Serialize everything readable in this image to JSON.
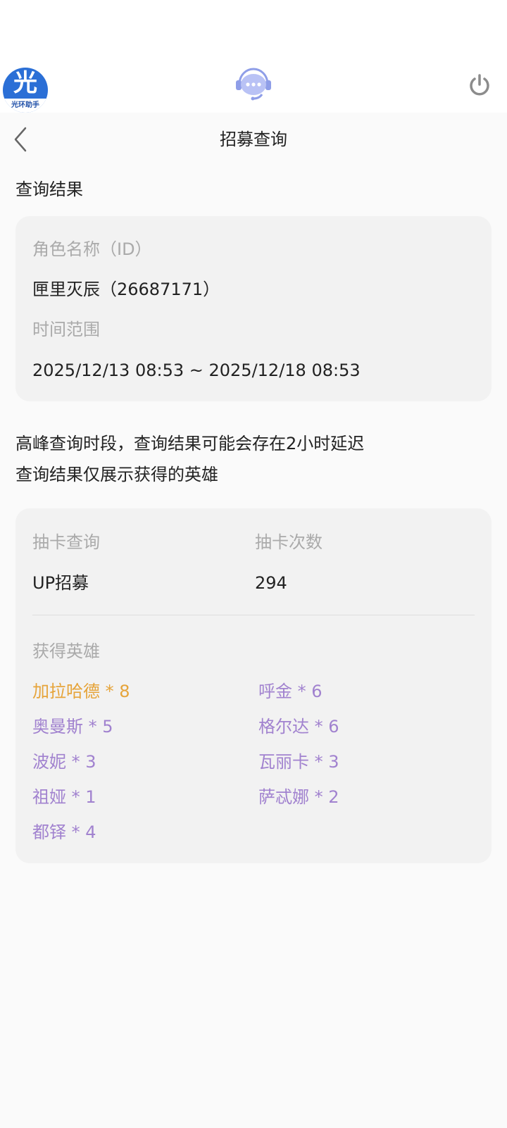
{
  "header": {
    "logo_glyph": "光",
    "logo_text": "光环助手",
    "chat_icon": "chat-bubble-icon",
    "power_icon": "power-icon"
  },
  "nav": {
    "back_icon": "chevron-left-icon",
    "title": "招募查询"
  },
  "section_title": "查询结果",
  "query": {
    "role_label": "角色名称（ID）",
    "role_value": "匣里灭辰（26687171）",
    "time_label": "时间范围",
    "time_value": "2025/12/13 08:53 ~ 2025/12/18 08:53"
  },
  "notes": [
    "高峰查询时段，查询结果可能会存在2小时延迟",
    "查询结果仅展示获得的英雄"
  ],
  "results": {
    "draw_type_label": "抽卡查询",
    "draw_count_label": "抽卡次数",
    "draw_type_value": "UP招募",
    "draw_count_value": "294",
    "heroes_label": "获得英雄",
    "heroes": [
      {
        "text": "加拉哈德 * 8",
        "color": "#e6a43a"
      },
      {
        "text": "呼金 * 6",
        "color": "#a182cf"
      },
      {
        "text": "奥曼斯 * 5",
        "color": "#a182cf"
      },
      {
        "text": "格尔达 * 6",
        "color": "#a182cf"
      },
      {
        "text": "波妮 * 3",
        "color": "#a182cf"
      },
      {
        "text": "瓦丽卡 * 3",
        "color": "#a182cf"
      },
      {
        "text": "祖娅 * 1",
        "color": "#a182cf"
      },
      {
        "text": "萨忒娜 * 2",
        "color": "#a182cf"
      },
      {
        "text": "都铎 * 4",
        "color": "#a182cf"
      }
    ]
  },
  "colors": {
    "accent_gold": "#e6a43a",
    "accent_purple": "#a182cf",
    "logo_blue": "#2b6fd6"
  }
}
